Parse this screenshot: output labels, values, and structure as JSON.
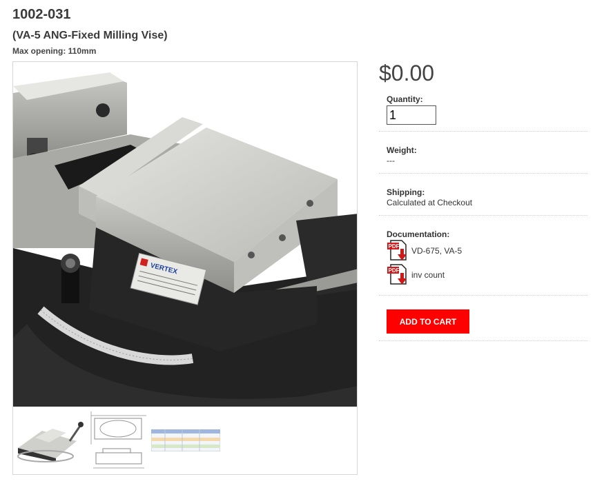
{
  "product": {
    "sku": "1002-031",
    "title": "(VA-5 ANG-Fixed Milling Vise)",
    "subtitle": "Max opening: 110mm",
    "image_logo_text": "VERTEX"
  },
  "purchase": {
    "price": "$0.00",
    "quantity_label": "Quantity:",
    "quantity_value": "1",
    "weight_label": "Weight:",
    "weight_value": "---",
    "shipping_label": "Shipping:",
    "shipping_value": "Calculated at Checkout",
    "documentation_label": "Documentation:",
    "documents": [
      {
        "label": "VD-675, VA-5",
        "icon": "pdf-download-icon"
      },
      {
        "label": "inv count",
        "icon": "pdf-download-icon"
      }
    ],
    "add_to_cart_label": "ADD TO CART",
    "pdf_badge": "PDF"
  },
  "colors": {
    "accent_red": "#ff0000",
    "vise_black": "#1f1f1f",
    "steel": "#c9c9c5"
  }
}
